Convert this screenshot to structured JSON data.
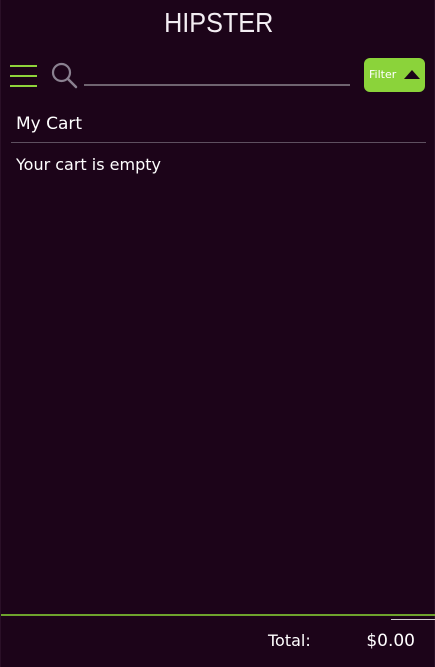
{
  "header": {
    "brand": "HIPSTER"
  },
  "toolbar": {
    "menu_icon": "hamburger-menu-icon",
    "search_icon": "search-icon",
    "search_value": "",
    "search_placeholder": "",
    "filter_label": "Filter",
    "filter_icon": "triangle-up-icon"
  },
  "cart": {
    "title": "My Cart",
    "empty_message": "Your cart is empty"
  },
  "footer": {
    "total_label": "Total:",
    "total_value": "$0.00"
  },
  "colors": {
    "background": "#1c0419",
    "accent": "#8bd33a",
    "divider": "#5e5060"
  }
}
